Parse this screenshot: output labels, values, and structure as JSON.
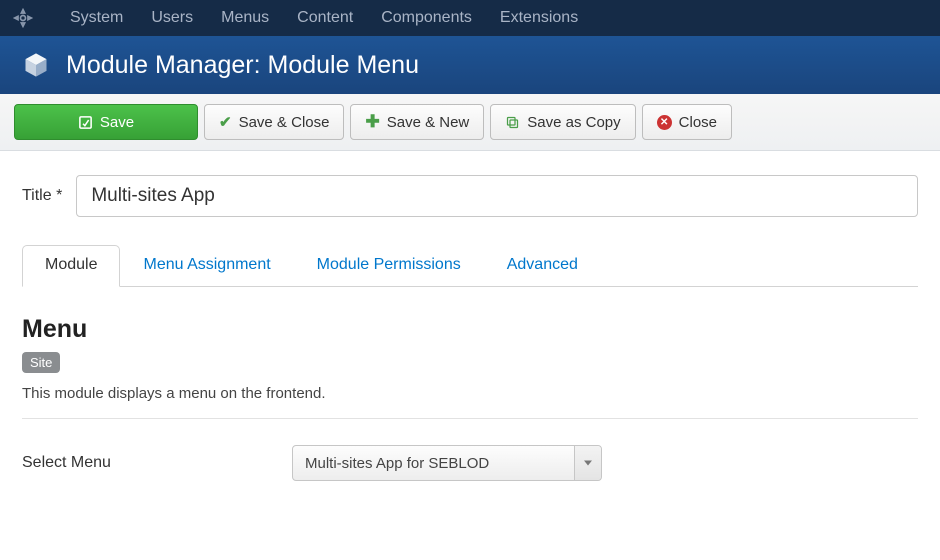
{
  "top_nav": {
    "items": [
      "System",
      "Users",
      "Menus",
      "Content",
      "Components",
      "Extensions"
    ]
  },
  "page_header": {
    "title": "Module Manager: Module Menu"
  },
  "toolbar": {
    "save": "Save",
    "save_close": "Save & Close",
    "save_new": "Save & New",
    "save_copy": "Save as Copy",
    "close": "Close"
  },
  "title_field": {
    "label": "Title *",
    "value": "Multi-sites App"
  },
  "tabs": {
    "items": [
      {
        "label": "Module",
        "active": true
      },
      {
        "label": "Menu Assignment",
        "active": false
      },
      {
        "label": "Module Permissions",
        "active": false
      },
      {
        "label": "Advanced",
        "active": false
      }
    ]
  },
  "module_section": {
    "heading": "Menu",
    "badge": "Site",
    "description": "This module displays a menu on the frontend.",
    "select_menu_label": "Select Menu",
    "select_menu_value": "Multi-sites App for SEBLOD"
  }
}
